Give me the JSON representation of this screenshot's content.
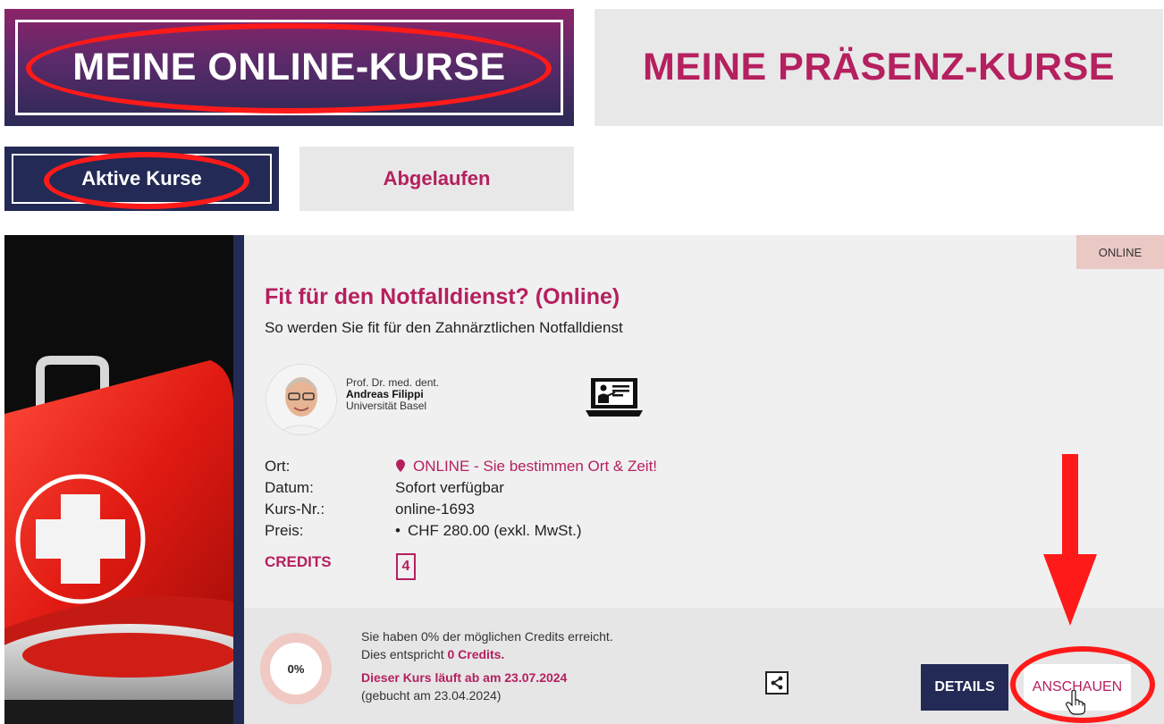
{
  "tabs": {
    "online": "MEINE ONLINE-KURSE",
    "presenz": "MEINE PRÄSENZ-KURSE"
  },
  "subtabs": {
    "active": "Aktive Kurse",
    "expired": "Abgelaufen"
  },
  "course": {
    "badge": "ONLINE",
    "title": "Fit für den Notfalldienst? (Online)",
    "subtitle": "So werden Sie fit für den Zahnärztlichen Notfalldienst",
    "speaker": {
      "title": "Prof. Dr. med. dent.",
      "name": "Andreas Filippi",
      "institution": "Universität Basel"
    },
    "info": {
      "ort_label": "Ort:",
      "ort_value": "ONLINE - Sie bestimmen Ort & Zeit!",
      "datum_label": "Datum:",
      "datum_value": "Sofort verfügbar",
      "kursnr_label": "Kurs-Nr.:",
      "kursnr_value": "online-1693",
      "preis_label": "Preis:",
      "preis_value": "CHF 280.00 (exkl. MwSt.)"
    },
    "credits_label": "CREDITS",
    "credits_value": "4"
  },
  "footer": {
    "progress_percent": "0%",
    "progress_fraction": 0,
    "line1": "Sie haben 0% der möglichen Credits erreicht.",
    "line2_prefix": "Dies entspricht ",
    "line2_credits": "0 Credits.",
    "expiry": "Dieser Kurs läuft ab am 23.07.2024",
    "booked": "(gebucht am 23.04.2024)",
    "details_button": "DETAILS",
    "view_button": "ANSCHAUEN"
  },
  "colors": {
    "accent": "#b5205f",
    "navy": "#232a55",
    "annotation_red": "#ff1a1a"
  }
}
